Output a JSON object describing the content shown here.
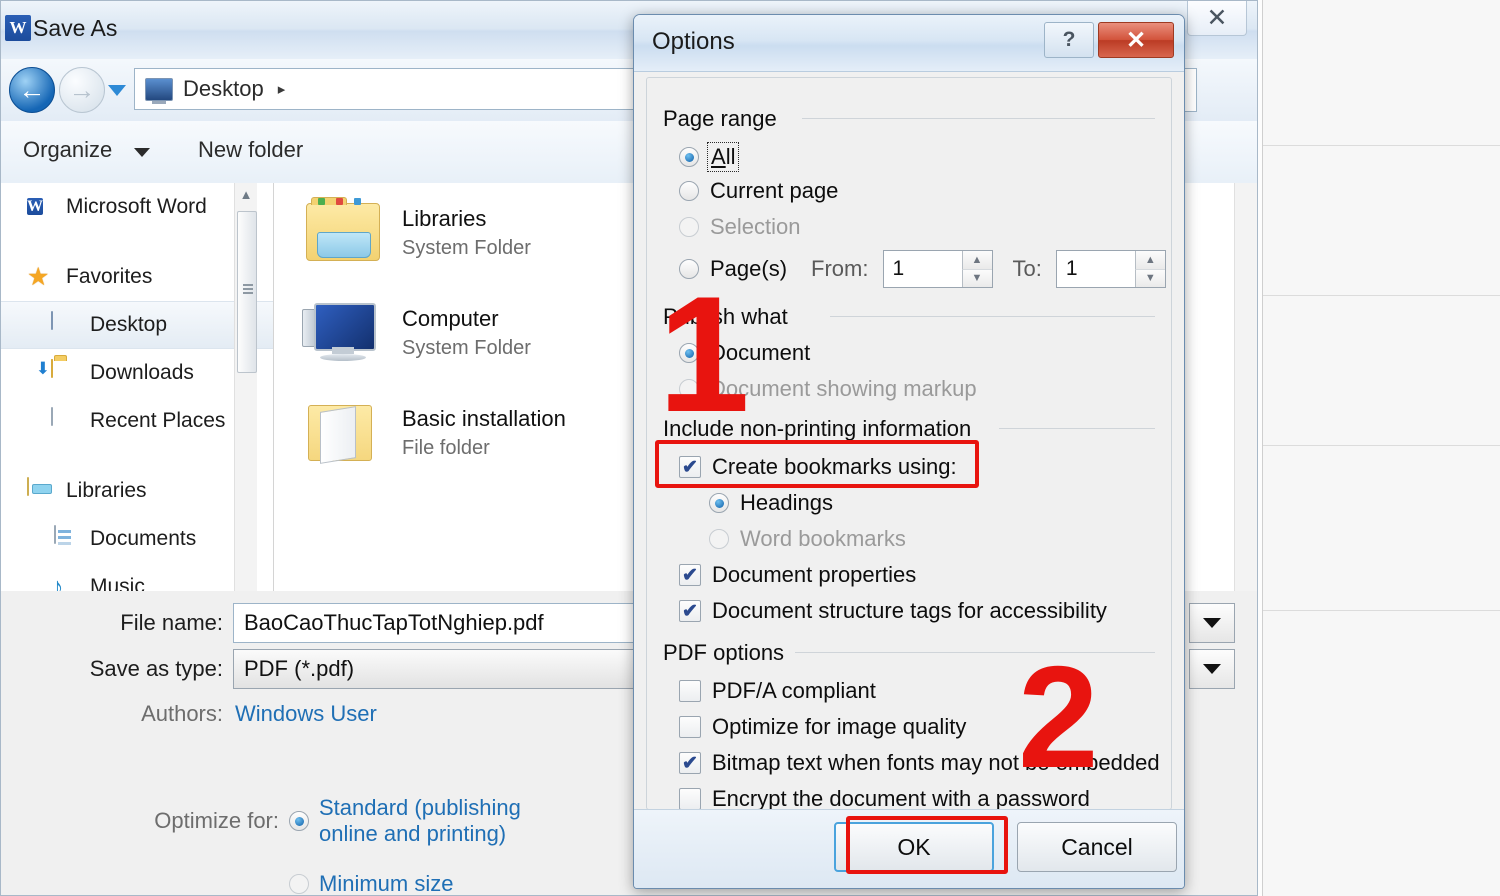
{
  "saveas": {
    "title": "Save As",
    "word_icon": "W",
    "close_icon": "✕",
    "nav": {
      "back_icon": "←",
      "forward_icon": "→",
      "history_icon": "chevron-down-icon",
      "breadcrumb_label": "Desktop",
      "breadcrumb_separator": "▸",
      "search_icon": "search-icon",
      "help_icon": "?"
    },
    "toolbar": {
      "organize_label": "Organize",
      "new_folder_label": "New folder"
    },
    "sidebar": [
      {
        "label": "Microsoft Word",
        "icon": "word-icon",
        "level": "root"
      },
      {
        "label": "Favorites",
        "icon": "star-icon",
        "level": "root"
      },
      {
        "label": "Desktop",
        "icon": "desktop-icon",
        "level": "child",
        "selected": true
      },
      {
        "label": "Downloads",
        "icon": "downloads-folder-icon",
        "level": "child"
      },
      {
        "label": "Recent Places",
        "icon": "recent-places-icon",
        "level": "child"
      },
      {
        "label": "Libraries",
        "icon": "libraries-icon",
        "level": "root"
      },
      {
        "label": "Documents",
        "icon": "documents-icon",
        "level": "child"
      },
      {
        "label": "Music",
        "icon": "music-icon",
        "level": "child"
      }
    ],
    "files": [
      {
        "name": "Libraries",
        "type": "System Folder",
        "icon": "libraries-folder-icon"
      },
      {
        "name": "Computer",
        "type": "System Folder",
        "icon": "computer-icon"
      },
      {
        "name": "Basic installation",
        "type": "File folder",
        "icon": "open-folder-icon"
      }
    ],
    "form": {
      "file_name_label": "File name:",
      "file_name_value": "BaoCaoThucTapTotNghiep.pdf",
      "save_as_type_label": "Save as type:",
      "save_as_type_value": "PDF (*.pdf)",
      "authors_label": "Authors:",
      "authors_value": "Windows User",
      "optimize_label": "Optimize for:",
      "optimize_standard": "Standard (publishing",
      "optimize_standard_line2": "online and printing)",
      "optimize_minimum": "Minimum size"
    }
  },
  "options": {
    "title": "Options",
    "help_icon": "?",
    "close_icon": "✕",
    "page_range": {
      "heading": "Page range",
      "all": "All",
      "current_page": "Current page",
      "selection": "Selection",
      "pages": "Page(s)",
      "from_label": "From:",
      "from_value": "1",
      "to_label": "To:",
      "to_value": "1",
      "spin_up": "▲",
      "spin_down": "▼"
    },
    "publish_what": {
      "heading": "Publish what",
      "document": "Document",
      "document_markup": "Document showing markup"
    },
    "non_printing": {
      "heading": "Include non-printing information",
      "create_bookmarks": "Create bookmarks using:",
      "headings": "Headings",
      "word_bookmarks": "Word bookmarks",
      "document_properties": "Document properties",
      "structure_tags": "Document structure tags for accessibility"
    },
    "pdf_options": {
      "heading": "PDF options",
      "pdfa": "PDF/A compliant",
      "optimize_image": "Optimize for image quality",
      "bitmap_text": "Bitmap text when fonts may not be embedded",
      "encrypt": "Encrypt the document with a password"
    },
    "buttons": {
      "ok": "OK",
      "cancel": "Cancel"
    },
    "check_mark": "✔"
  },
  "annotations": {
    "step_one": "1",
    "step_two": "2",
    "highlight_color": "#e8140f"
  }
}
